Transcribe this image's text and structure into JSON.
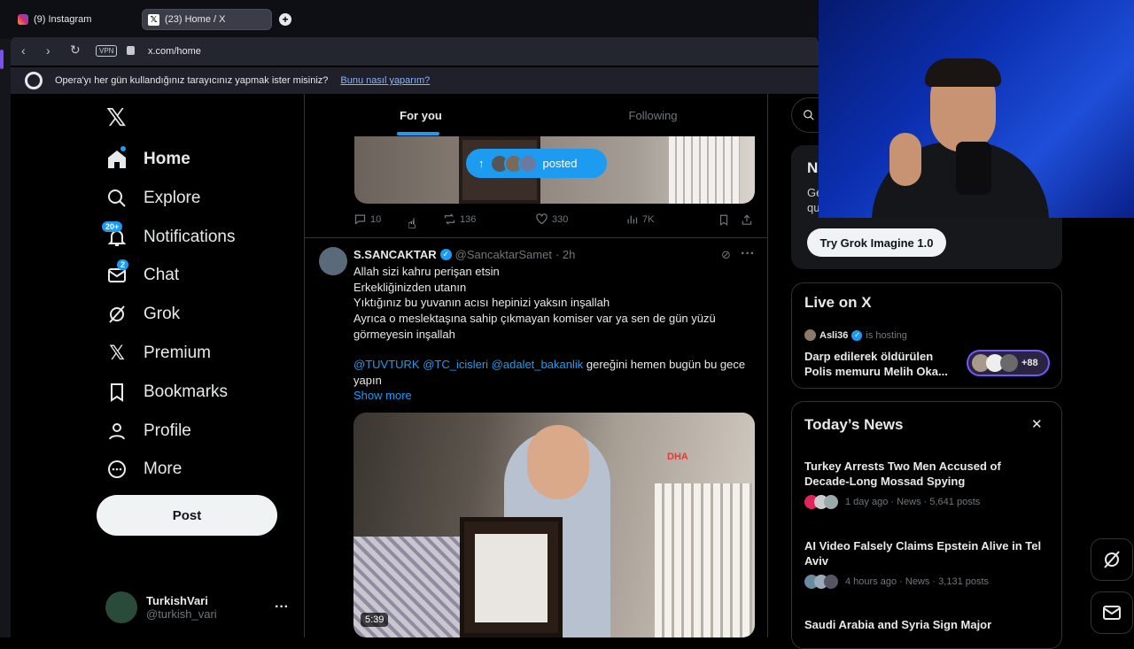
{
  "browser": {
    "tabs": [
      {
        "label": "(9) Instagram"
      },
      {
        "label": "(23) Home / X"
      }
    ],
    "vpn_label": "VPN",
    "url": "x.com/home",
    "opera_prompt": "Opera'yı her gün kullandığınız tarayıcınız yapmak ister misiniz?",
    "opera_link": "Bunu nasıl yaparım?"
  },
  "sidebar": {
    "items": [
      {
        "label": "Home",
        "icon": "home-icon"
      },
      {
        "label": "Explore",
        "icon": "search-icon"
      },
      {
        "label": "Notifications",
        "icon": "bell-icon",
        "badge": "20+"
      },
      {
        "label": "Chat",
        "icon": "mail-icon",
        "badge": "2"
      },
      {
        "label": "Grok",
        "icon": "grok-icon"
      },
      {
        "label": "Premium",
        "icon": "x-logo-icon"
      },
      {
        "label": "Bookmarks",
        "icon": "bookmark-icon"
      },
      {
        "label": "Profile",
        "icon": "person-icon"
      },
      {
        "label": "More",
        "icon": "more-circle-icon"
      }
    ],
    "post_label": "Post",
    "account": {
      "name": "TurkishVari",
      "handle": "@turkish_vari"
    }
  },
  "feed": {
    "tabs": [
      {
        "label": "For you"
      },
      {
        "label": "Following"
      }
    ],
    "new_posts_pill": "posted",
    "prev_post_actions": {
      "replies": "10",
      "reposts": "136",
      "likes": "330",
      "views": "7K"
    },
    "post": {
      "name": "S.SANCAKTAR",
      "handle": "@SancaktarSamet",
      "time": "· 2h",
      "lines": [
        "Allah sizi kahru perişan etsin",
        "Erkekliğinizden utanın",
        "Yıktığınız bu yuvanın acısı hepinizi yaksın inşallah",
        "Ayrıca o meslektaşına sahip çıkmayan komiser var ya sen de gün yüzü",
        "görmeyesin inşallah"
      ],
      "mentions": "@TUVTURK @TC_icisleri @adalet_bakanlik",
      "mention_tail": "gereğini hemen bugün bu gece",
      "last_line": "yapın",
      "show_more": "Show more",
      "video_duration": "5:39",
      "watermark": "DHA"
    }
  },
  "right": {
    "grok_button": "Try Grok Imagine 1.0",
    "grok_partial_title": "N",
    "grok_partial_lines": [
      "Ge",
      "qu"
    ],
    "live": {
      "title": "Live on X",
      "host": "Asli36",
      "host_suffix": "is hosting",
      "topic": "Darp edilerek öldürülen Polis memuru Melih Oka...",
      "listeners": "+88"
    },
    "news": {
      "title": "Today’s News",
      "items": [
        {
          "title": "Turkey Arrests Two Men Accused of Decade-Long Mossad Spying",
          "meta": "1 day ago · News · 5,641 posts"
        },
        {
          "title": "AI Video Falsely Claims Epstein Alive in Tel Aviv",
          "meta": "4 hours ago · News · 3,131 posts"
        },
        {
          "title": "Saudi Arabia and Syria Sign Major",
          "meta": ""
        }
      ]
    }
  },
  "colors": {
    "accent": "#1d9bf0",
    "background": "#000000",
    "border": "#2f3336",
    "muted": "#71767b"
  }
}
